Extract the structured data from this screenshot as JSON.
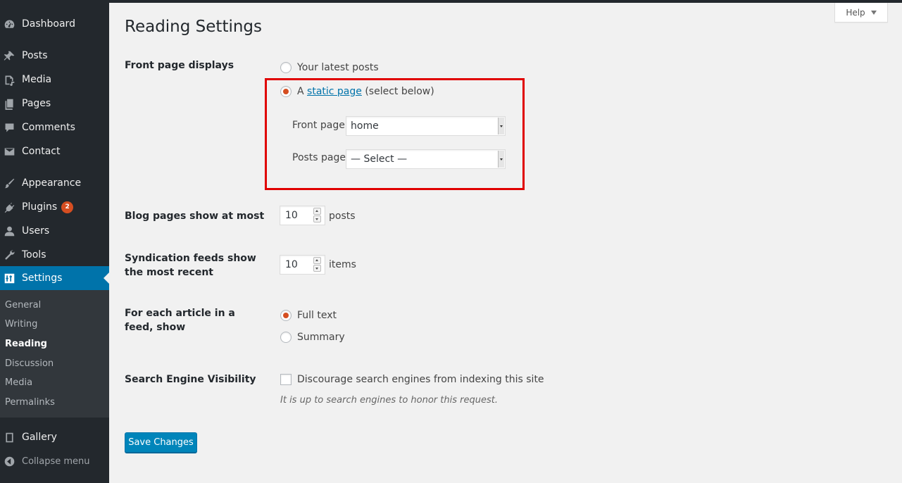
{
  "sidebar": {
    "items": [
      {
        "label": "Dashboard",
        "icon": "dashboard-icon"
      },
      {
        "label": "Posts",
        "icon": "pin-icon"
      },
      {
        "label": "Media",
        "icon": "media-icon"
      },
      {
        "label": "Pages",
        "icon": "pages-icon"
      },
      {
        "label": "Comments",
        "icon": "comment-icon"
      },
      {
        "label": "Contact",
        "icon": "mail-icon"
      },
      {
        "label": "Appearance",
        "icon": "brush-icon"
      },
      {
        "label": "Plugins",
        "icon": "plugin-icon",
        "badge": "2"
      },
      {
        "label": "Users",
        "icon": "user-icon"
      },
      {
        "label": "Tools",
        "icon": "wrench-icon"
      },
      {
        "label": "Settings",
        "icon": "settings-icon",
        "active": true
      },
      {
        "label": "Gallery",
        "icon": "gallery-icon"
      },
      {
        "label": "Collapse menu",
        "icon": "collapse-icon"
      }
    ],
    "submenu": [
      "General",
      "Writing",
      "Reading",
      "Discussion",
      "Media",
      "Permalinks"
    ],
    "submenu_current": "Reading"
  },
  "page": {
    "title": "Reading Settings",
    "help_label": "Help"
  },
  "front_page": {
    "heading": "Front page displays",
    "option_latest": "Your latest posts",
    "option_static_prefix": "A",
    "option_static_link": "static page",
    "option_static_suffix": "(select below)",
    "selected": "static",
    "front_page_label": "Front page:",
    "front_page_value": "home",
    "posts_page_label": "Posts page:",
    "posts_page_value": "— Select —"
  },
  "blog_pages": {
    "heading": "Blog pages show at most",
    "value": "10",
    "unit": "posts"
  },
  "syndication": {
    "heading": "Syndication feeds show the most recent",
    "value": "10",
    "unit": "items"
  },
  "feed_article": {
    "heading": "For each article in a feed, show",
    "option_full": "Full text",
    "option_summary": "Summary",
    "selected": "full"
  },
  "search_visibility": {
    "heading": "Search Engine Visibility",
    "checkbox_label": "Discourage search engines from indexing this site",
    "checked": false,
    "description": "It is up to search engines to honor this request."
  },
  "actions": {
    "save_label": "Save Changes"
  },
  "colors": {
    "sidebar_bg": "#23282d",
    "submenu_bg": "#32373c",
    "active_accent": "#0073aa",
    "radio_checked": "#d54e21",
    "highlight_border": "#e00000",
    "page_bg": "#f1f1f1"
  }
}
